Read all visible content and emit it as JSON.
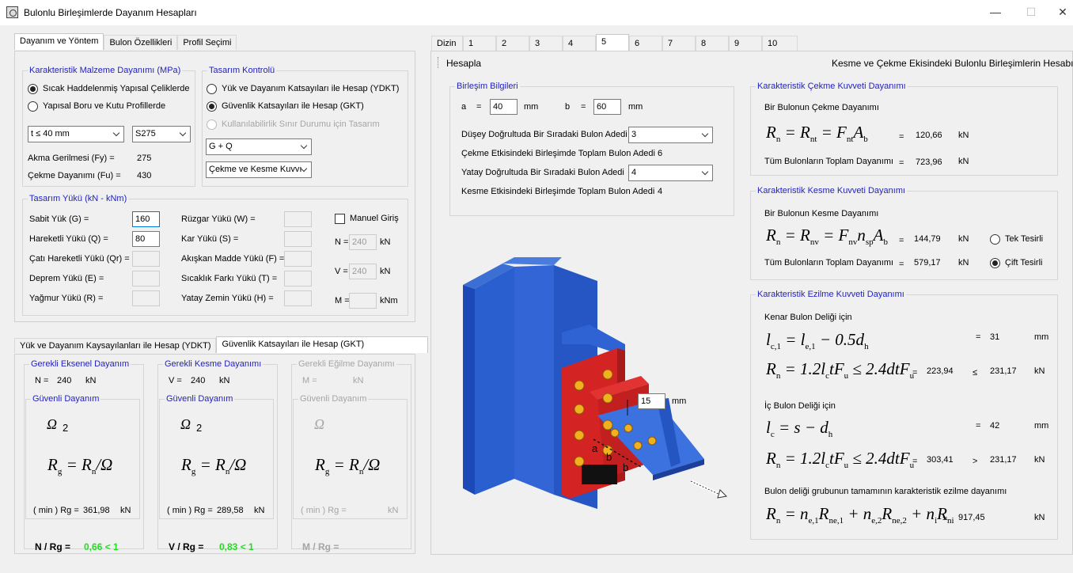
{
  "window": {
    "title": "Bulonlu Birleşimlerde Dayanım Hesapları",
    "min": "—",
    "max": "☐",
    "close": "✕"
  },
  "left_tabs": [
    "Dayanım ve Yöntem",
    "Bulon Özellikleri",
    "Profil Seçimi"
  ],
  "material": {
    "title": "Karakteristik Malzeme Dayanımı (MPa)",
    "opt1": "Sıcak Haddelenmiş Yapısal Çeliklerde",
    "opt2": "Yapısal Boru ve Kutu Profillerde",
    "thickness": "t ≤ 40 mm",
    "grade": "S275",
    "fy_label": "Akma Gerilmesi (Fy) =",
    "fy": "275",
    "fu_label": "Çekme Dayanımı (Fu) =",
    "fu": "430"
  },
  "design": {
    "title": "Tasarım Kontrolü",
    "opt1": "Yük ve Dayanım Katsayıları ile Hesap (YDKT)",
    "opt2": "Güvenlik Katsayıları ile Hesap (GKT)",
    "opt3": "Kullanılabilirlik Sınır Durumu için Tasarım",
    "combo": "G + Q",
    "mode": "Çekme ve Kesme Kuvvı"
  },
  "loads": {
    "title": "Tasarım Yükü (kN - kNm)",
    "g_label": "Sabit Yük (G) =",
    "g": "160",
    "q_label": "Hareketli Yükü (Q) =",
    "q": "80",
    "qr_label": "Çatı Hareketli Yükü (Qr) =",
    "e_label": "Deprem Yükü (E) =",
    "r_label": "Yağmur Yükü (R) =",
    "w_label": "Rüzgar Yükü (W) =",
    "s_label": "Kar Yükü (S) =",
    "f_label": "Akışkan Madde Yükü (F) =",
    "t_label": "Sıcaklık Farkı Yükü (T) =",
    "h_label": "Yatay Zemin Yükü (H) =",
    "manual": "Manuel Giriş",
    "n_label": "N =",
    "n": "240",
    "n_unit": "kN",
    "v_label": "V =",
    "v": "240",
    "v_unit": "kN",
    "m_label": "M =",
    "m_unit": "kNm"
  },
  "bottom_tabs": [
    "Yük ve Dayanım Kaysayılanları ile Hesap (YDKT)",
    "Güvenlik Katsayıları ile Hesap (GKT)"
  ],
  "axial": {
    "title": "Gerekli Eksenel Dayanım",
    "val_label": "N =",
    "val": "240",
    "unit": "kN",
    "safe": "Güvenli Dayanım",
    "omega": "Ω",
    "omega_val": "2",
    "min_label": "( min ) Rg =",
    "min": "361,98",
    "min_unit": "kN",
    "ratio_label": "N / Rg =",
    "ratio": "0,66 < 1"
  },
  "shear": {
    "title": "Gerekli Kesme Dayanımı",
    "val_label": "V =",
    "val": "240",
    "unit": "kN",
    "safe": "Güvenli Dayanım",
    "omega": "Ω",
    "omega_val": "2",
    "min_label": "( min ) Rg =",
    "min": "289,58",
    "min_unit": "kN",
    "ratio_label": "V / Rg =",
    "ratio": "0,83 < 1"
  },
  "bending": {
    "title": "Gerekli Eğilme Dayanımı",
    "val_label": "M =",
    "unit": "kN",
    "safe": "Güvenli Dayanım",
    "omega": "Ω",
    "min_label": "( min ) Rg =",
    "min_unit": "kN",
    "ratio_label": "M / Rg ="
  },
  "right_tabs": [
    "Dizin",
    "1",
    "2",
    "3",
    "4",
    "5",
    "6",
    "7",
    "8",
    "9",
    "10"
  ],
  "toolbar": {
    "calc": "Hesapla",
    "heading": "Kesme ve Çekme Ekisindeki Bulonlu Birleşimlerin Hesabı"
  },
  "conn": {
    "title": "Birleşim Bilgileri",
    "a_label": "a",
    "eq": "=",
    "a": "40",
    "a_unit": "mm",
    "b_label": "b",
    "b": "60",
    "b_unit": "mm",
    "vrow_label": "Düşey Doğrultuda Bir Sıradaki Bulon Adedi",
    "vrow": "3",
    "tension_label": "Çekme Etkisindeki Birleşimde Toplam Bulon Adedi",
    "tension": "6",
    "hrow_label": "Yatay Doğrultuda Bir Sıradaki Bulon Adedi",
    "hrow": "4",
    "shear_label": "Kesme Etkisindeki Birleşimde Toplam Bulon Adedi",
    "shear": "4"
  },
  "drawing": {
    "thk": "15",
    "thk_unit": "mm",
    "a": "a",
    "b1": "b",
    "b2": "b"
  },
  "tensile": {
    "title": "Karakteristik Çekme Kuvveti Dayanımı",
    "sub": "Bir Bulonun Çekme Dayanımı",
    "eq": "=",
    "val": "120,66",
    "unit": "kN",
    "all_label": "Tüm Bulonların  Toplam Dayanımı",
    "all": "723,96",
    "all_unit": "kN"
  },
  "shearcap": {
    "title": "Karakteristik Kesme Kuvveti Dayanımı",
    "sub": "Bir Bulonun Kesme Dayanımı",
    "eq": "=",
    "val": "144,79",
    "unit": "kN",
    "all_label": "Tüm Bulonların  Toplam Dayanımı",
    "all": "579,17",
    "all_unit": "kN",
    "single": "Tek Tesirli",
    "double": "Çift Tesirli"
  },
  "bearing": {
    "title": "Karakteristik Ezilme Kuvveti Dayanımı",
    "edge": "Kenar Bulon Deliği için",
    "eq": "=",
    "lc1": "31",
    "lc1_unit": "mm",
    "rn1": "223,94",
    "le": "≤",
    "rn1b": "231,17",
    "unit": "kN",
    "inner": "İç Bulon Deliği için",
    "lc": "42",
    "lc_unit": "mm",
    "rn2": "303,41",
    "gt": ">",
    "rn2b": "231,17",
    "group": "Bulon deliği grubunun tamamının karakteristik ezilme dayanımı",
    "total": "917,45",
    "total_unit": "kN"
  }
}
